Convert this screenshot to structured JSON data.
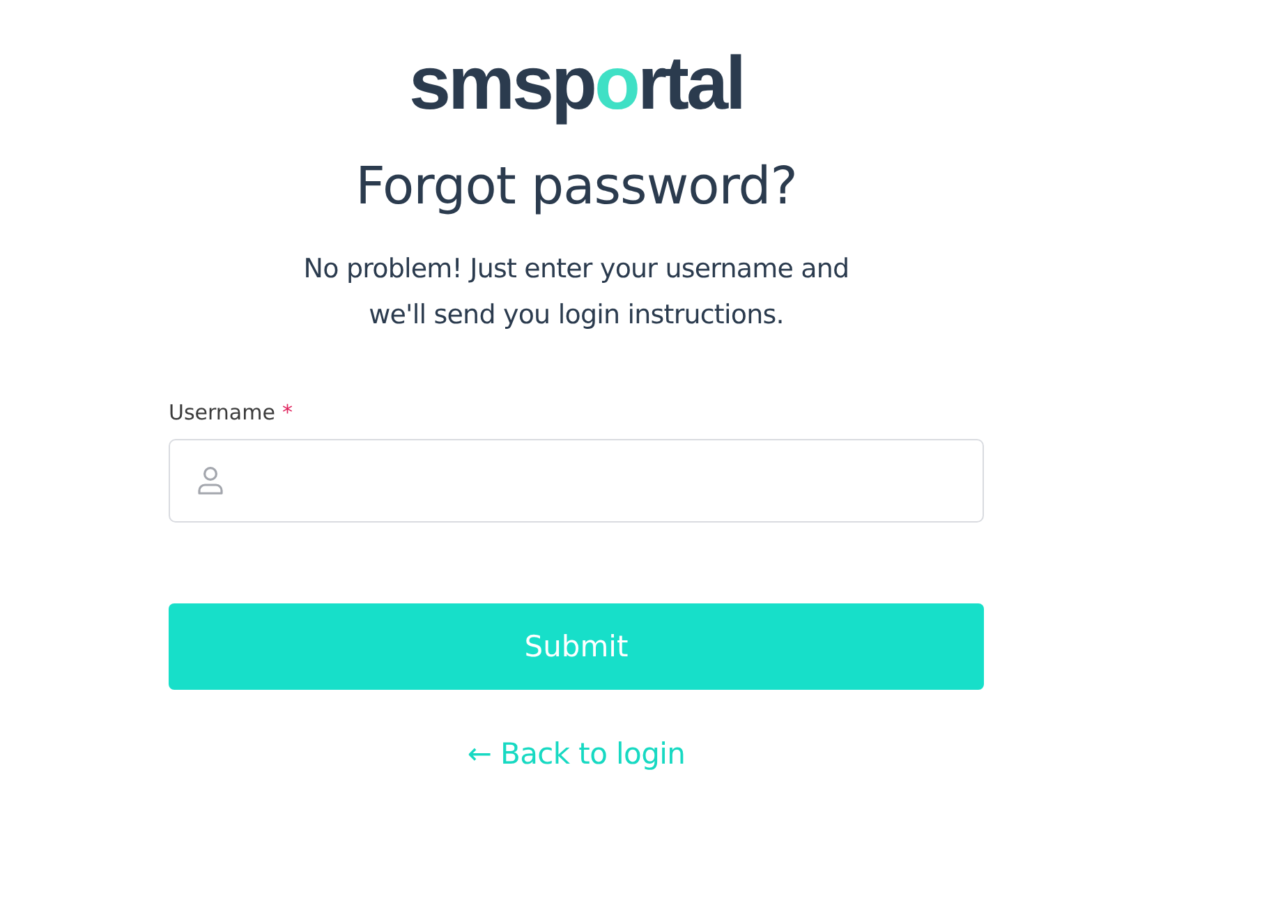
{
  "logo": {
    "before": "smsp",
    "accent": "o",
    "after": "rtal"
  },
  "heading": "Forgot password?",
  "description": [
    "No problem! Just enter your username and",
    "we'll send you login instructions."
  ],
  "field": {
    "label": "Username",
    "required_mark": "*"
  },
  "submit": "Submit",
  "back_link": "← Back to login"
}
